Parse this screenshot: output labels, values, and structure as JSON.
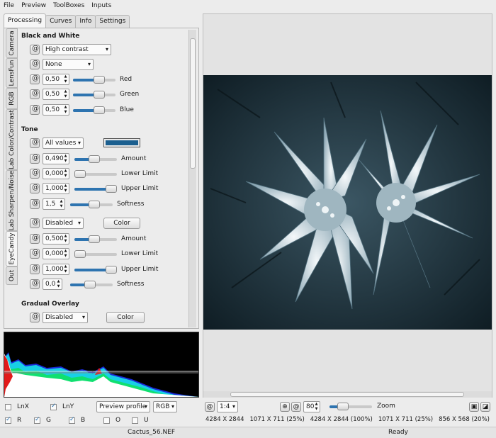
{
  "menu": [
    "File",
    "Preview",
    "ToolBoxes",
    "Inputs"
  ],
  "tabs": [
    "Processing",
    "Curves",
    "Info",
    "Settings"
  ],
  "vtabs": [
    "Camera",
    "LensFun",
    "RGB",
    "Lab Color/Contrast",
    "Lab Sharpen/Noise",
    "EyeCandy",
    "Out"
  ],
  "bw": {
    "title": "Black and White",
    "preset": "High contrast",
    "filter": "None",
    "red": {
      "value": "0,50",
      "label": "Red",
      "level": 0.65
    },
    "green": {
      "value": "0,50",
      "label": "Green",
      "level": 0.65
    },
    "blue": {
      "value": "0,50",
      "label": "Blue",
      "level": 0.65
    }
  },
  "tone": {
    "title": "Tone",
    "mode": "All values",
    "color_swatch": "#1b5f8f",
    "amount": {
      "value": "0,490",
      "label": "Amount",
      "level": 0.45
    },
    "lower": {
      "value": "0,000",
      "label": "Lower Limit",
      "level": 0.0
    },
    "upper": {
      "value": "1,000",
      "label": "Upper Limit",
      "level": 1.0
    },
    "softness": {
      "value": "1,5",
      "label": "Softness",
      "level": 0.6
    }
  },
  "tone2": {
    "mode": "Disabled",
    "color_btn": "Color",
    "amount": {
      "value": "0,500",
      "label": "Amount",
      "level": 0.45
    },
    "lower": {
      "value": "0,000",
      "label": "Lower Limit",
      "level": 0.0
    },
    "upper": {
      "value": "1,000",
      "label": "Upper Limit",
      "level": 1.0
    },
    "softness": {
      "value": "0,0",
      "label": "Softness",
      "level": 0.45
    }
  },
  "gradual": {
    "title": "Gradual Overlay",
    "mode": "Disabled",
    "color_btn": "Color"
  },
  "histogram_controls": {
    "lnx": "LnX",
    "lny": "LnY",
    "profile": "Preview profile",
    "space": "RGB",
    "r": "R",
    "g": "G",
    "b": "B",
    "o": "O",
    "u": "U"
  },
  "preview_toolbar": {
    "scale": "1:4",
    "zoom_value": "80",
    "zoom_label": "Zoom",
    "zoom_level": 0.25
  },
  "sizes": [
    "4284 X 2844",
    "1071 X 711 (25%)",
    "4284 X 2844 (100%)",
    "1071 X 711 (25%)",
    "856 X 568 (20%)"
  ],
  "status": {
    "file": "Cactus_56.NEF",
    "state": "Ready"
  },
  "colors": {
    "accent": "#2e74b0",
    "tone_color": "#1b5f8f"
  }
}
